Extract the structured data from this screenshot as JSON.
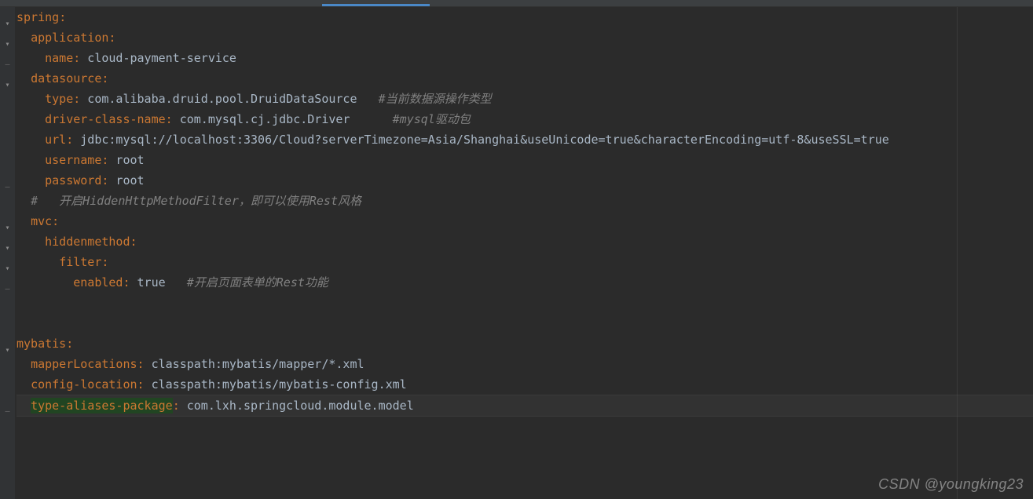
{
  "watermark": "CSDN @youngking23",
  "yaml": {
    "lines": [
      {
        "indent": 0,
        "key": "spring",
        "colon": true
      },
      {
        "indent": 2,
        "key": "application",
        "colon": true
      },
      {
        "indent": 4,
        "key": "name",
        "colon": true,
        "value": " cloud-payment-service"
      },
      {
        "indent": 2,
        "key": "datasource",
        "colon": true
      },
      {
        "indent": 4,
        "key": "type",
        "colon": true,
        "value": " com.alibaba.druid.pool.DruidDataSource   ",
        "comment": "#当前数据源操作类型"
      },
      {
        "indent": 4,
        "key": "driver-class-name",
        "colon": true,
        "value": " com.mysql.cj.jdbc.Driver      ",
        "comment": "#mysql驱动包"
      },
      {
        "indent": 4,
        "key": "url",
        "colon": true,
        "value": " jdbc:mysql://localhost:3306/Cloud?serverTimezone=Asia/Shanghai&useUnicode=true&characterEncoding=utf-8&useSSL=true"
      },
      {
        "indent": 4,
        "key": "username",
        "colon": true,
        "value": " root"
      },
      {
        "indent": 4,
        "key": "password",
        "colon": true,
        "value": " root"
      },
      {
        "indent": 2,
        "raw_comment": "#   开启HiddenHttpMethodFilter，即可以使用Rest风格"
      },
      {
        "indent": 2,
        "key": "mvc",
        "colon": true
      },
      {
        "indent": 4,
        "key": "hiddenmethod",
        "colon": true
      },
      {
        "indent": 6,
        "key": "filter",
        "colon": true
      },
      {
        "indent": 8,
        "key": "enabled",
        "colon": true,
        "value": " true   ",
        "comment": "#开启页面表单的Rest功能"
      },
      {
        "blank": true
      },
      {
        "blank": true
      },
      {
        "indent": 0,
        "key": "mybatis",
        "colon": true
      },
      {
        "indent": 2,
        "key": "mapperLocations",
        "colon": true,
        "value": " classpath:mybatis/mapper/*.xml"
      },
      {
        "indent": 2,
        "key": "config-location",
        "colon": true,
        "value": " classpath:mybatis/mybatis-config.xml"
      },
      {
        "indent": 2,
        "key": "type-aliases-package",
        "colon": true,
        "value": " com.lxh.springcloud.module.model",
        "highlight": true
      }
    ]
  },
  "gutter": {
    "folds": [
      {
        "row": 0,
        "kind": "open"
      },
      {
        "row": 1,
        "kind": "open"
      },
      {
        "row": 2,
        "kind": "end"
      },
      {
        "row": 3,
        "kind": "open"
      },
      {
        "row": 8,
        "kind": "end"
      },
      {
        "row": 10,
        "kind": "open"
      },
      {
        "row": 11,
        "kind": "open"
      },
      {
        "row": 12,
        "kind": "open"
      },
      {
        "row": 13,
        "kind": "end"
      },
      {
        "row": 16,
        "kind": "open"
      },
      {
        "row": 19,
        "kind": "end"
      }
    ]
  }
}
